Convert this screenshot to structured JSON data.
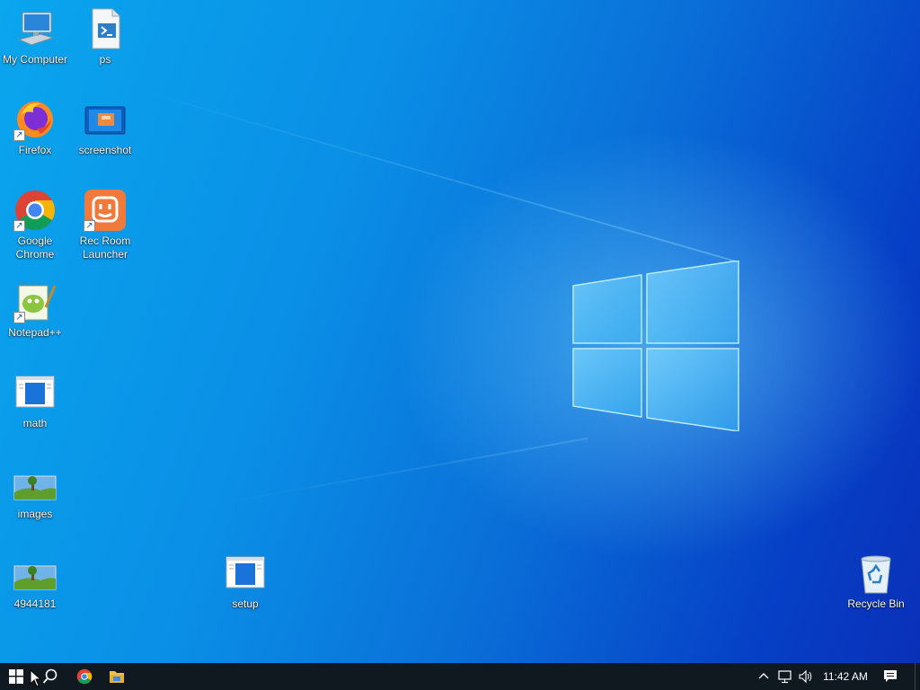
{
  "desktop": {
    "icons": [
      {
        "label": "My Computer",
        "icon": "computer-icon"
      },
      {
        "label": "ps",
        "icon": "powershell-file-icon"
      },
      {
        "label": "Firefox",
        "icon": "firefox-icon"
      },
      {
        "label": "screenshot",
        "icon": "screenshot-image-icon"
      },
      {
        "label": "Google Chrome",
        "icon": "chrome-icon"
      },
      {
        "label": "Rec Room Launcher",
        "icon": "rec-room-icon"
      },
      {
        "label": "Notepad++",
        "icon": "notepad-plus-plus-icon"
      },
      {
        "label": "math",
        "icon": "app-window-icon"
      },
      {
        "label": "images",
        "icon": "landscape-image-icon"
      },
      {
        "label": "4944181",
        "icon": "landscape-image-icon"
      },
      {
        "label": "setup",
        "icon": "app-window-icon"
      },
      {
        "label": "Recycle Bin",
        "icon": "recycle-bin-icon"
      }
    ]
  },
  "taskbar": {
    "start": "windows-start-icon",
    "search": "search-icon",
    "pinned": [
      "chrome-icon",
      "file-explorer-icon"
    ],
    "tray": {
      "chevron": "chevron-up-icon",
      "network": "network-icon",
      "volume": "speaker-icon",
      "clock": "11:42 AM",
      "notifications": "action-center-icon"
    }
  },
  "colors": {
    "accent": "#0a8fe6",
    "taskbar": "#101820"
  }
}
